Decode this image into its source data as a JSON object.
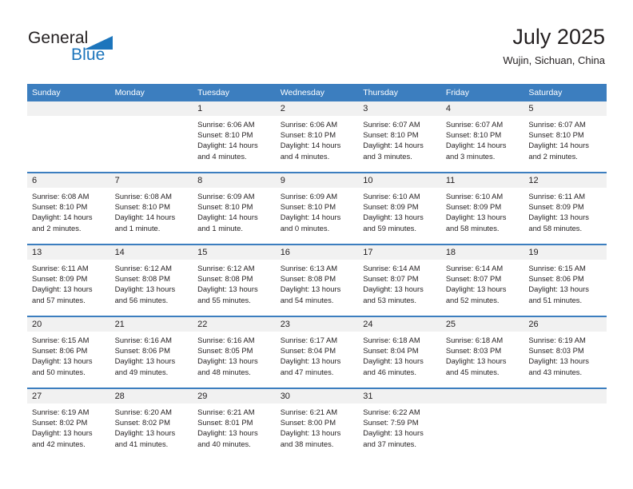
{
  "brand": {
    "name_part1": "General",
    "name_part2": "Blue"
  },
  "header": {
    "title": "July 2025",
    "subtitle": "Wujin, Sichuan, China"
  },
  "weekdays": [
    "Sunday",
    "Monday",
    "Tuesday",
    "Wednesday",
    "Thursday",
    "Friday",
    "Saturday"
  ],
  "colors": {
    "header_blue": "#3c7ebf",
    "brand_blue": "#1c75bc",
    "daynum_band": "#f1f1f1",
    "text": "#231f20"
  },
  "weeks": [
    [
      {
        "day": "",
        "lines": []
      },
      {
        "day": "",
        "lines": []
      },
      {
        "day": "1",
        "lines": [
          "Sunrise: 6:06 AM",
          "Sunset: 8:10 PM",
          "Daylight: 14 hours and 4 minutes."
        ]
      },
      {
        "day": "2",
        "lines": [
          "Sunrise: 6:06 AM",
          "Sunset: 8:10 PM",
          "Daylight: 14 hours and 4 minutes."
        ]
      },
      {
        "day": "3",
        "lines": [
          "Sunrise: 6:07 AM",
          "Sunset: 8:10 PM",
          "Daylight: 14 hours and 3 minutes."
        ]
      },
      {
        "day": "4",
        "lines": [
          "Sunrise: 6:07 AM",
          "Sunset: 8:10 PM",
          "Daylight: 14 hours and 3 minutes."
        ]
      },
      {
        "day": "5",
        "lines": [
          "Sunrise: 6:07 AM",
          "Sunset: 8:10 PM",
          "Daylight: 14 hours and 2 minutes."
        ]
      }
    ],
    [
      {
        "day": "6",
        "lines": [
          "Sunrise: 6:08 AM",
          "Sunset: 8:10 PM",
          "Daylight: 14 hours and 2 minutes."
        ]
      },
      {
        "day": "7",
        "lines": [
          "Sunrise: 6:08 AM",
          "Sunset: 8:10 PM",
          "Daylight: 14 hours and 1 minute."
        ]
      },
      {
        "day": "8",
        "lines": [
          "Sunrise: 6:09 AM",
          "Sunset: 8:10 PM",
          "Daylight: 14 hours and 1 minute."
        ]
      },
      {
        "day": "9",
        "lines": [
          "Sunrise: 6:09 AM",
          "Sunset: 8:10 PM",
          "Daylight: 14 hours and 0 minutes."
        ]
      },
      {
        "day": "10",
        "lines": [
          "Sunrise: 6:10 AM",
          "Sunset: 8:09 PM",
          "Daylight: 13 hours and 59 minutes."
        ]
      },
      {
        "day": "11",
        "lines": [
          "Sunrise: 6:10 AM",
          "Sunset: 8:09 PM",
          "Daylight: 13 hours and 58 minutes."
        ]
      },
      {
        "day": "12",
        "lines": [
          "Sunrise: 6:11 AM",
          "Sunset: 8:09 PM",
          "Daylight: 13 hours and 58 minutes."
        ]
      }
    ],
    [
      {
        "day": "13",
        "lines": [
          "Sunrise: 6:11 AM",
          "Sunset: 8:09 PM",
          "Daylight: 13 hours and 57 minutes."
        ]
      },
      {
        "day": "14",
        "lines": [
          "Sunrise: 6:12 AM",
          "Sunset: 8:08 PM",
          "Daylight: 13 hours and 56 minutes."
        ]
      },
      {
        "day": "15",
        "lines": [
          "Sunrise: 6:12 AM",
          "Sunset: 8:08 PM",
          "Daylight: 13 hours and 55 minutes."
        ]
      },
      {
        "day": "16",
        "lines": [
          "Sunrise: 6:13 AM",
          "Sunset: 8:08 PM",
          "Daylight: 13 hours and 54 minutes."
        ]
      },
      {
        "day": "17",
        "lines": [
          "Sunrise: 6:14 AM",
          "Sunset: 8:07 PM",
          "Daylight: 13 hours and 53 minutes."
        ]
      },
      {
        "day": "18",
        "lines": [
          "Sunrise: 6:14 AM",
          "Sunset: 8:07 PM",
          "Daylight: 13 hours and 52 minutes."
        ]
      },
      {
        "day": "19",
        "lines": [
          "Sunrise: 6:15 AM",
          "Sunset: 8:06 PM",
          "Daylight: 13 hours and 51 minutes."
        ]
      }
    ],
    [
      {
        "day": "20",
        "lines": [
          "Sunrise: 6:15 AM",
          "Sunset: 8:06 PM",
          "Daylight: 13 hours and 50 minutes."
        ]
      },
      {
        "day": "21",
        "lines": [
          "Sunrise: 6:16 AM",
          "Sunset: 8:06 PM",
          "Daylight: 13 hours and 49 minutes."
        ]
      },
      {
        "day": "22",
        "lines": [
          "Sunrise: 6:16 AM",
          "Sunset: 8:05 PM",
          "Daylight: 13 hours and 48 minutes."
        ]
      },
      {
        "day": "23",
        "lines": [
          "Sunrise: 6:17 AM",
          "Sunset: 8:04 PM",
          "Daylight: 13 hours and 47 minutes."
        ]
      },
      {
        "day": "24",
        "lines": [
          "Sunrise: 6:18 AM",
          "Sunset: 8:04 PM",
          "Daylight: 13 hours and 46 minutes."
        ]
      },
      {
        "day": "25",
        "lines": [
          "Sunrise: 6:18 AM",
          "Sunset: 8:03 PM",
          "Daylight: 13 hours and 45 minutes."
        ]
      },
      {
        "day": "26",
        "lines": [
          "Sunrise: 6:19 AM",
          "Sunset: 8:03 PM",
          "Daylight: 13 hours and 43 minutes."
        ]
      }
    ],
    [
      {
        "day": "27",
        "lines": [
          "Sunrise: 6:19 AM",
          "Sunset: 8:02 PM",
          "Daylight: 13 hours and 42 minutes."
        ]
      },
      {
        "day": "28",
        "lines": [
          "Sunrise: 6:20 AM",
          "Sunset: 8:02 PM",
          "Daylight: 13 hours and 41 minutes."
        ]
      },
      {
        "day": "29",
        "lines": [
          "Sunrise: 6:21 AM",
          "Sunset: 8:01 PM",
          "Daylight: 13 hours and 40 minutes."
        ]
      },
      {
        "day": "30",
        "lines": [
          "Sunrise: 6:21 AM",
          "Sunset: 8:00 PM",
          "Daylight: 13 hours and 38 minutes."
        ]
      },
      {
        "day": "31",
        "lines": [
          "Sunrise: 6:22 AM",
          "Sunset: 7:59 PM",
          "Daylight: 13 hours and 37 minutes."
        ]
      },
      {
        "day": "",
        "lines": []
      },
      {
        "day": "",
        "lines": []
      }
    ]
  ]
}
